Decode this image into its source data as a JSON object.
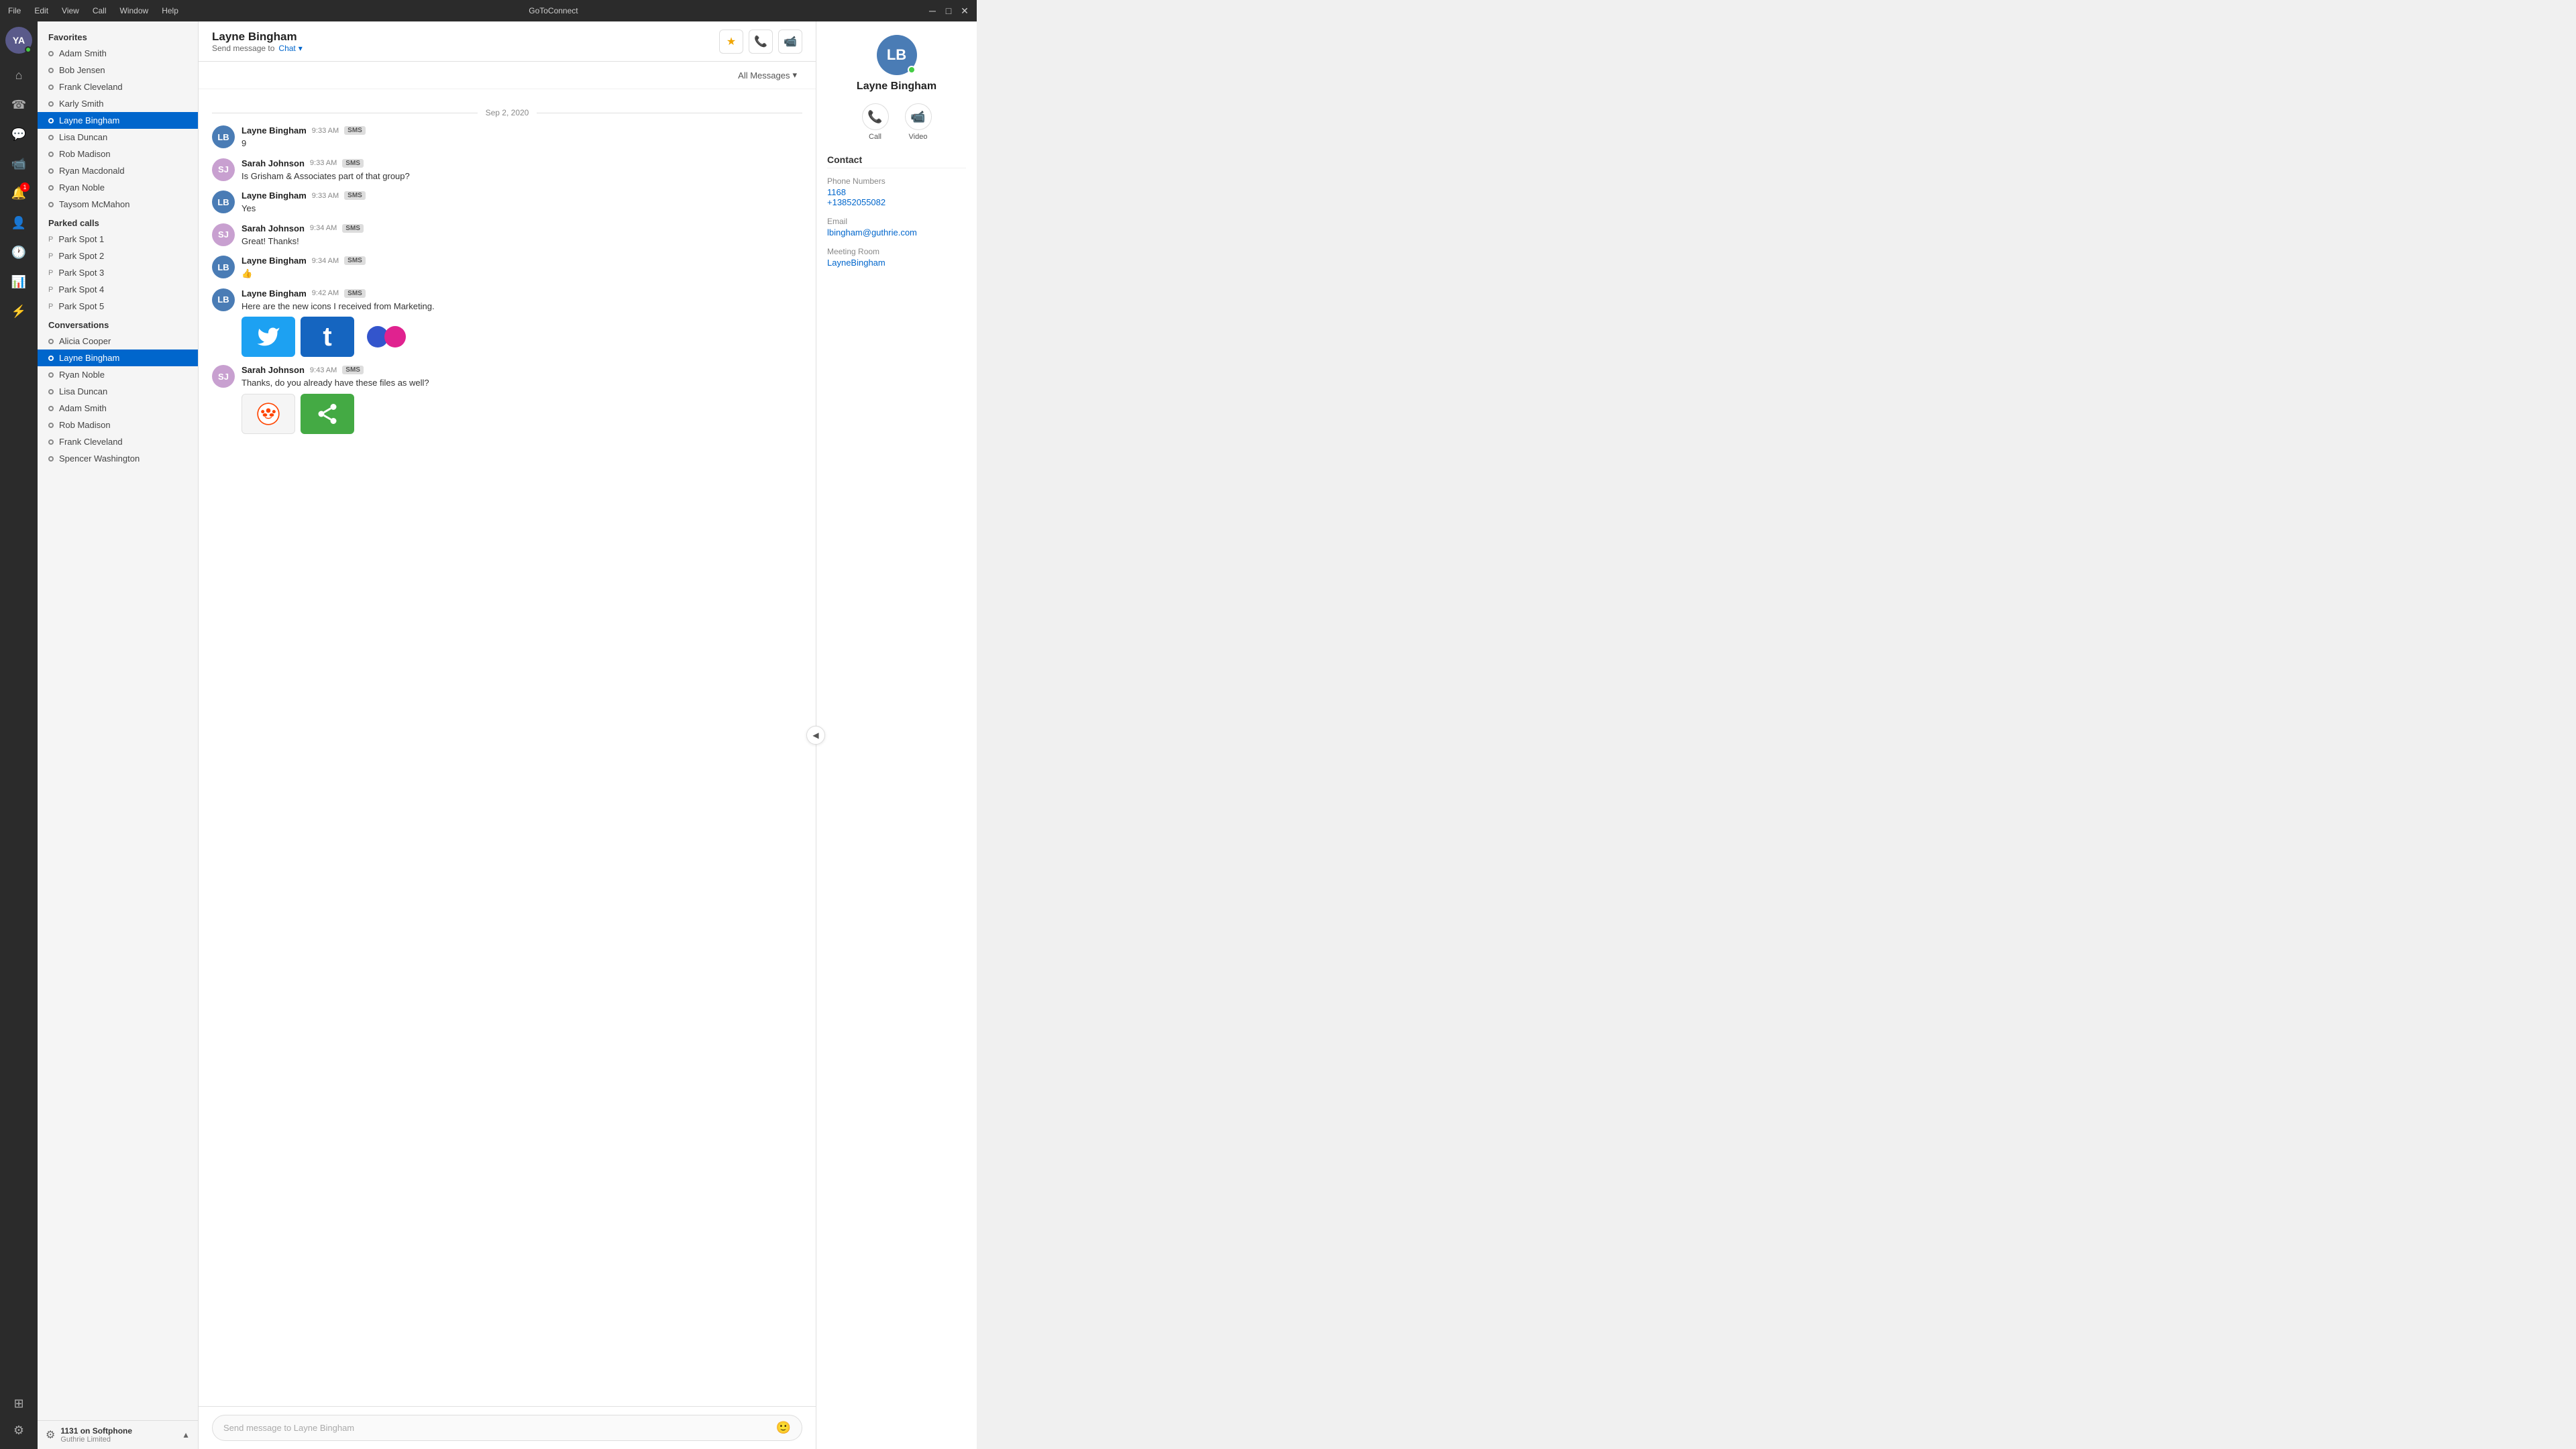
{
  "titlebar": {
    "title": "GoToConnect",
    "menu": [
      "File",
      "Edit",
      "View",
      "Call",
      "Window",
      "Help"
    ]
  },
  "nav": {
    "avatar_initials": "YA",
    "buttons": [
      {
        "name": "home",
        "icon": "⌂",
        "active": false
      },
      {
        "name": "phone",
        "icon": "☎",
        "active": false
      },
      {
        "name": "chat",
        "icon": "💬",
        "active": true
      },
      {
        "name": "video",
        "icon": "📹",
        "active": false
      },
      {
        "name": "voicemail",
        "icon": "🔴",
        "badge": "1"
      },
      {
        "name": "contacts",
        "icon": "👤",
        "active": false
      },
      {
        "name": "history",
        "icon": "🕐",
        "active": false
      },
      {
        "name": "analytics",
        "icon": "📊",
        "active": false
      },
      {
        "name": "integrations",
        "icon": "⚡",
        "active": false
      }
    ],
    "bottom_buttons": [
      {
        "name": "apps",
        "icon": "⊞"
      },
      {
        "name": "settings",
        "icon": "⚙"
      }
    ]
  },
  "sidebar": {
    "favorites_title": "Favorites",
    "favorites": [
      {
        "name": "Adam Smith",
        "active": false
      },
      {
        "name": "Bob Jensen",
        "active": false
      },
      {
        "name": "Frank Cleveland",
        "active": false
      },
      {
        "name": "Karly Smith",
        "active": false
      },
      {
        "name": "Layne Bingham",
        "active": true
      },
      {
        "name": "Lisa Duncan",
        "active": false
      },
      {
        "name": "Rob Madison",
        "active": false
      },
      {
        "name": "Ryan Macdonald",
        "active": false
      },
      {
        "name": "Ryan Noble",
        "active": false
      },
      {
        "name": "Taysom McMahon",
        "active": false
      }
    ],
    "parked_title": "Parked calls",
    "parked": [
      {
        "name": "Park Spot 1"
      },
      {
        "name": "Park Spot 2"
      },
      {
        "name": "Park Spot 3"
      },
      {
        "name": "Park Spot 4"
      },
      {
        "name": "Park Spot 5"
      }
    ],
    "conversations_title": "Conversations",
    "conversations": [
      {
        "name": "Alicia Cooper",
        "active": false
      },
      {
        "name": "Layne Bingham",
        "active": true
      },
      {
        "name": "Ryan Noble",
        "active": false
      },
      {
        "name": "Lisa Duncan",
        "active": false
      },
      {
        "name": "Adam Smith",
        "active": false
      },
      {
        "name": "Rob Madison",
        "active": false
      },
      {
        "name": "Frank Cleveland",
        "active": false
      },
      {
        "name": "Spencer Washington",
        "active": false
      }
    ],
    "footer": {
      "main": "1131 on Softphone",
      "sub": "Guthrie Limited"
    }
  },
  "chat": {
    "contact_name": "Layne Bingham",
    "send_message_to": "Send message to",
    "channel": "Chat",
    "filter": "All Messages",
    "date_separator": "Sep 2, 2020",
    "messages": [
      {
        "sender": "Layne Bingham",
        "avatar_type": "lb",
        "time": "9:33 AM",
        "badge": "SMS",
        "text": "9",
        "images": []
      },
      {
        "sender": "Sarah Johnson",
        "avatar_type": "sj",
        "time": "9:33 AM",
        "badge": "SMS",
        "text": "Is Grisham & Associates part of that group?",
        "images": []
      },
      {
        "sender": "Layne Bingham",
        "avatar_type": "lb",
        "time": "9:33 AM",
        "badge": "SMS",
        "text": "Yes",
        "images": []
      },
      {
        "sender": "Sarah Johnson",
        "avatar_type": "sj",
        "time": "9:34 AM",
        "badge": "SMS",
        "text": "Great! Thanks!",
        "images": []
      },
      {
        "sender": "Layne Bingham",
        "avatar_type": "lb",
        "time": "9:34 AM",
        "badge": "SMS",
        "text": "👍",
        "images": []
      },
      {
        "sender": "Layne Bingham",
        "avatar_type": "lb",
        "time": "9:42 AM",
        "badge": "SMS",
        "text": "Here are the new icons I received from Marketing.",
        "images": [
          "twitter",
          "twitter2",
          "circles"
        ]
      },
      {
        "sender": "Sarah Johnson",
        "avatar_type": "sj",
        "time": "9:43 AM",
        "badge": "SMS",
        "text": "Thanks, do you already have these files as well?",
        "images": [
          "reddit",
          "share"
        ]
      }
    ],
    "input_placeholder": "Send message to Layne Bingham"
  },
  "contact_panel": {
    "initials": "LB",
    "name": "Layne Bingham",
    "actions": [
      {
        "label": "Call",
        "icon": "📞"
      },
      {
        "label": "Video",
        "icon": "📹"
      }
    ],
    "section_title": "Contact",
    "fields": [
      {
        "label": "Phone Numbers",
        "values": [
          "1168",
          "+13852055082"
        ]
      },
      {
        "label": "Email",
        "values": [
          "lbingham@guthrie.com"
        ]
      },
      {
        "label": "Meeting Room",
        "values": [
          "LayneBingham"
        ]
      }
    ]
  }
}
